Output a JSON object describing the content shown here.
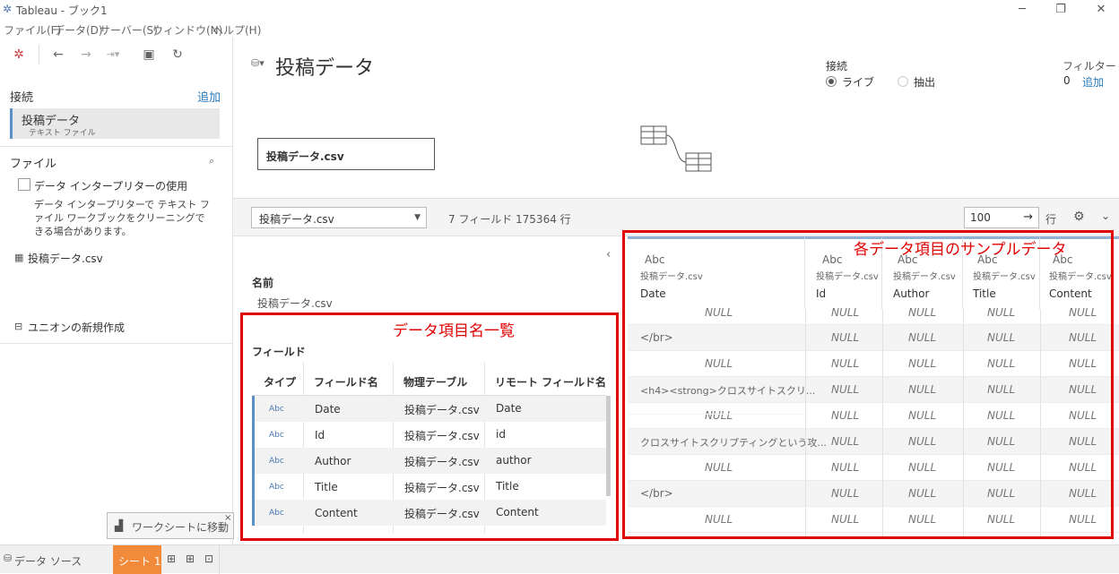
{
  "app": {
    "window_title": "Tableau - ブック1",
    "menu": [
      "ファイル(F)",
      "データ(D)",
      "サーバー(S)",
      "ウィンドウ(N)",
      "ヘルプ(H)"
    ]
  },
  "left": {
    "connections_label": "接続",
    "add_label": "追加",
    "connection_name": "投稿データ",
    "connection_type": "テキスト ファイル",
    "files_label": "ファイル",
    "interpreter_label": "データ インタープリターの使用",
    "interpreter_desc": "データ インタープリターで テキスト ファイル ワークブックをクリーニングできる場合があります。",
    "file_item": "投稿データ.csv",
    "union_label": "ユニオンの新規作成"
  },
  "canvas": {
    "title": "投稿データ",
    "table_name": "投稿データ.csv",
    "connection_label": "接続",
    "live_label": "ライブ",
    "extract_label": "抽出",
    "filter_label": "フィルター",
    "filter_count": "0",
    "filter_add": "追加"
  },
  "gridbar": {
    "selected_table": "投稿データ.csv",
    "summary": "7 フィールド 175364 行",
    "rows_value": "100",
    "rows_label": "行"
  },
  "meta": {
    "name_label": "名前",
    "name_value": "投稿データ.csv",
    "fields_label": "フィールド",
    "columns": [
      "タイプ",
      "フィールド名",
      "物理テーブル",
      "リモート フィールド名"
    ],
    "rows": [
      {
        "type": "Abc",
        "field": "Date",
        "table": "投稿データ.csv",
        "remote": "Date"
      },
      {
        "type": "Abc",
        "field": "Id",
        "table": "投稿データ.csv",
        "remote": "id"
      },
      {
        "type": "Abc",
        "field": "Author",
        "table": "投稿データ.csv",
        "remote": "author"
      },
      {
        "type": "Abc",
        "field": "Title",
        "table": "投稿データ.csv",
        "remote": "Title"
      },
      {
        "type": "Abc",
        "field": "Content",
        "table": "投稿データ.csv",
        "remote": "Content"
      }
    ]
  },
  "data": {
    "columns": [
      {
        "type": "Abc",
        "source": "投稿データ.csv",
        "name": "Date"
      },
      {
        "type": "Abc",
        "source": "投稿データ.csv",
        "name": "Id"
      },
      {
        "type": "Abc",
        "source": "投稿データ.csv",
        "name": "Author"
      },
      {
        "type": "Abc",
        "source": "投稿データ.csv",
        "name": "Title"
      },
      {
        "type": "Abc",
        "source": "投稿データ.csv",
        "name": "Content"
      }
    ],
    "rows": [
      [
        "NULL",
        "NULL",
        "NULL",
        "NULL",
        "NULL"
      ],
      [
        "</br>",
        "NULL",
        "NULL",
        "NULL",
        "NULL"
      ],
      [
        "NULL",
        "NULL",
        "NULL",
        "NULL",
        "NULL"
      ],
      [
        "<h4><strong>クロスサイトスクリ...",
        "NULL",
        "NULL",
        "NULL",
        "NULL"
      ],
      [
        "NULL",
        "NULL",
        "NULL",
        "NULL",
        "NULL"
      ],
      [
        "クロスサイトスクリプティングという攻...",
        "NULL",
        "NULL",
        "NULL",
        "NULL"
      ],
      [
        "NULL",
        "NULL",
        "NULL",
        "NULL",
        "NULL"
      ],
      [
        "</br>",
        "NULL",
        "NULL",
        "NULL",
        "NULL"
      ],
      [
        "NULL",
        "NULL",
        "NULL",
        "NULL",
        "NULL"
      ]
    ]
  },
  "annotations": {
    "fields_list": "データ項目名一覧",
    "sample_data": "各データ項目のサンプルデータ"
  },
  "bottom": {
    "source_tab": "データ ソース",
    "sheet_tab": "シート 1",
    "tooltip": "ワークシートに移動"
  },
  "colors": {
    "accent": "#2a7ab8",
    "sheet_tab": "#f28a3c",
    "annotation": "#e00000"
  }
}
